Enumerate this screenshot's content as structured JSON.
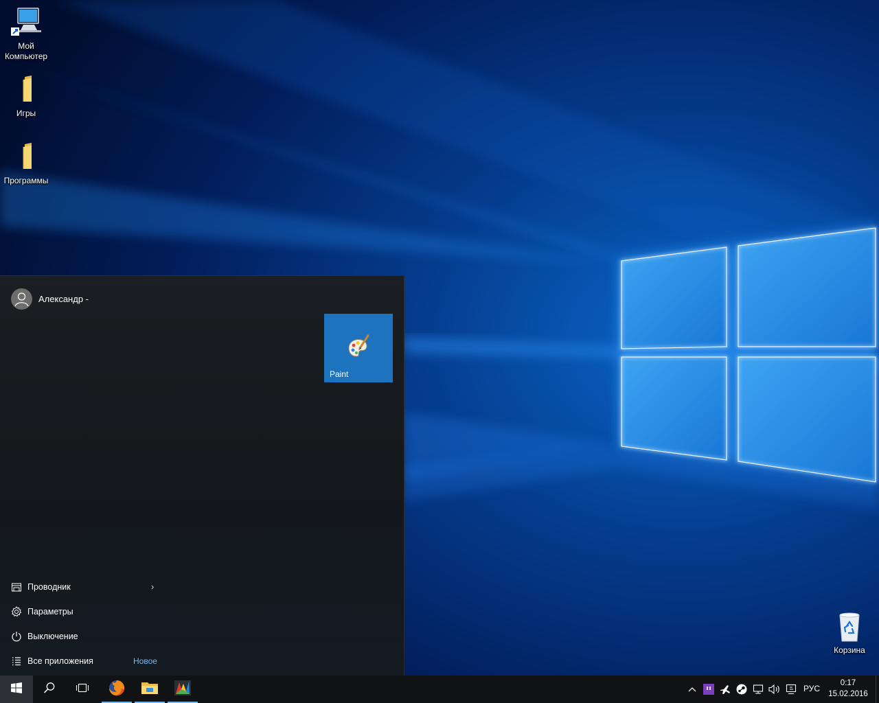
{
  "desktop": {
    "icons": [
      {
        "label_line1": "Мой",
        "label_line2": "Компьютер",
        "icon": "computer-icon"
      },
      {
        "label": "Игры",
        "icon": "folder-icon"
      },
      {
        "label": "Программы",
        "icon": "folder-icon"
      },
      {
        "label": "Корзина",
        "icon": "recycle-bin-icon"
      }
    ]
  },
  "start_menu": {
    "user_name": "Александр -",
    "tile_paint_label": "Paint",
    "items": [
      {
        "label": "Проводник",
        "icon": "file-explorer-icon"
      },
      {
        "label": "Параметры",
        "icon": "settings-gear-icon"
      },
      {
        "label": "Выключение",
        "icon": "power-icon"
      },
      {
        "label": "Все приложения",
        "icon": "all-apps-icon",
        "badge": "Новое"
      }
    ]
  },
  "taskbar": {
    "apps": [
      "start-windows-icon",
      "search-icon",
      "task-view-icon",
      "firefox-icon",
      "file-explorer-icon",
      "avg-icon"
    ],
    "language": "РУС",
    "time": "0:17",
    "date": "15.02.2016"
  },
  "colors": {
    "accent": "#1e73be",
    "taskbar": "#101214",
    "start_menu": "#16191d",
    "link": "#7ab6f0"
  }
}
